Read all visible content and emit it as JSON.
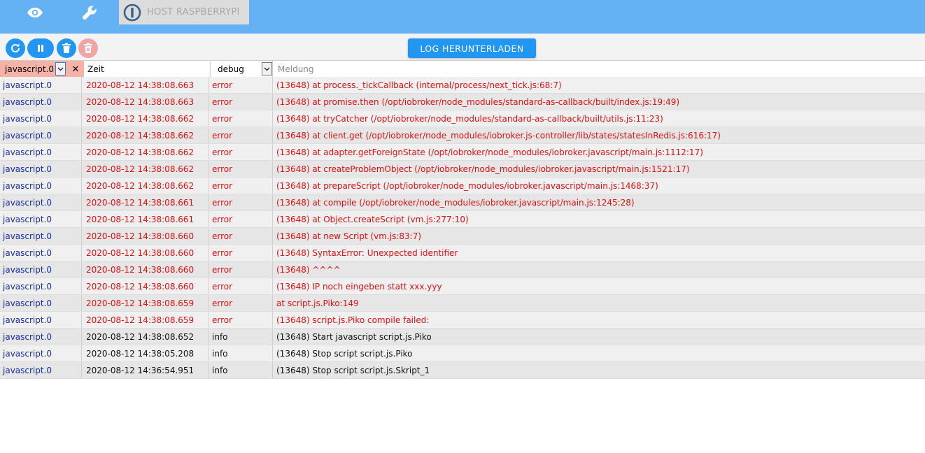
{
  "appbar": {
    "view_icon": "eye-icon",
    "settings_icon": "wrench-icon",
    "host_logo_icon": "iobroker-logo-icon",
    "host_label": "HOST RASPBERRYPI",
    "color": "#64b2f3"
  },
  "toolbar": {
    "refresh_icon": "refresh-icon",
    "pause_icon": "pause-icon",
    "delete_icon": "trash-icon",
    "delete_all_icon": "trash-x-icon",
    "download_label": "LOG HERUNTERLADEN",
    "accent": "#2196f3"
  },
  "filters": {
    "source_value": "javascript.0",
    "time_placeholder": "Zeit",
    "level_value": "debug",
    "message_placeholder": "Meldung",
    "source_highlight": "#f5b3a8"
  },
  "colors": {
    "error": "#e01010",
    "source": "#1730a8"
  },
  "rows": [
    {
      "src": "javascript.0",
      "time": "2020-08-12 14:38:08.663",
      "level": "error",
      "msg": "(13648) at process._tickCallback (internal/process/next_tick.js:68:7)"
    },
    {
      "src": "javascript.0",
      "time": "2020-08-12 14:38:08.663",
      "level": "error",
      "msg": "(13648) at promise.then (/opt/iobroker/node_modules/standard-as-callback/built/index.js:19:49)"
    },
    {
      "src": "javascript.0",
      "time": "2020-08-12 14:38:08.662",
      "level": "error",
      "msg": "(13648) at tryCatcher (/opt/iobroker/node_modules/standard-as-callback/built/utils.js:11:23)"
    },
    {
      "src": "javascript.0",
      "time": "2020-08-12 14:38:08.662",
      "level": "error",
      "msg": "(13648) at client.get (/opt/iobroker/node_modules/iobroker.js-controller/lib/states/statesInRedis.js:616:17)"
    },
    {
      "src": "javascript.0",
      "time": "2020-08-12 14:38:08.662",
      "level": "error",
      "msg": "(13648) at adapter.getForeignState (/opt/iobroker/node_modules/iobroker.javascript/main.js:1112:17)"
    },
    {
      "src": "javascript.0",
      "time": "2020-08-12 14:38:08.662",
      "level": "error",
      "msg": "(13648) at createProblemObject (/opt/iobroker/node_modules/iobroker.javascript/main.js:1521:17)"
    },
    {
      "src": "javascript.0",
      "time": "2020-08-12 14:38:08.662",
      "level": "error",
      "msg": "(13648) at prepareScript (/opt/iobroker/node_modules/iobroker.javascript/main.js:1468:37)"
    },
    {
      "src": "javascript.0",
      "time": "2020-08-12 14:38:08.661",
      "level": "error",
      "msg": "(13648) at compile (/opt/iobroker/node_modules/iobroker.javascript/main.js:1245:28)"
    },
    {
      "src": "javascript.0",
      "time": "2020-08-12 14:38:08.661",
      "level": "error",
      "msg": "(13648) at Object.createScript (vm.js:277:10)"
    },
    {
      "src": "javascript.0",
      "time": "2020-08-12 14:38:08.660",
      "level": "error",
      "msg": "(13648) at new Script (vm.js:83:7)"
    },
    {
      "src": "javascript.0",
      "time": "2020-08-12 14:38:08.660",
      "level": "error",
      "msg": "(13648) SyntaxError: Unexpected identifier"
    },
    {
      "src": "javascript.0",
      "time": "2020-08-12 14:38:08.660",
      "level": "error",
      "msg": "(13648) ^^^^"
    },
    {
      "src": "javascript.0",
      "time": "2020-08-12 14:38:08.660",
      "level": "error",
      "msg": "(13648) IP noch eingeben statt xxx.yyy"
    },
    {
      "src": "javascript.0",
      "time": "2020-08-12 14:38:08.659",
      "level": "error",
      "msg": "at script.js.Piko:149"
    },
    {
      "src": "javascript.0",
      "time": "2020-08-12 14:38:08.659",
      "level": "error",
      "msg": "(13648) script.js.Piko compile failed:"
    },
    {
      "src": "javascript.0",
      "time": "2020-08-12 14:38:08.652",
      "level": "info",
      "msg": "(13648) Start javascript script.js.Piko"
    },
    {
      "src": "javascript.0",
      "time": "2020-08-12 14:38:05.208",
      "level": "info",
      "msg": "(13648) Stop script script.js.Piko"
    },
    {
      "src": "javascript.0",
      "time": "2020-08-12 14:36:54.951",
      "level": "info",
      "msg": "(13648) Stop script script.js.Skript_1"
    }
  ]
}
